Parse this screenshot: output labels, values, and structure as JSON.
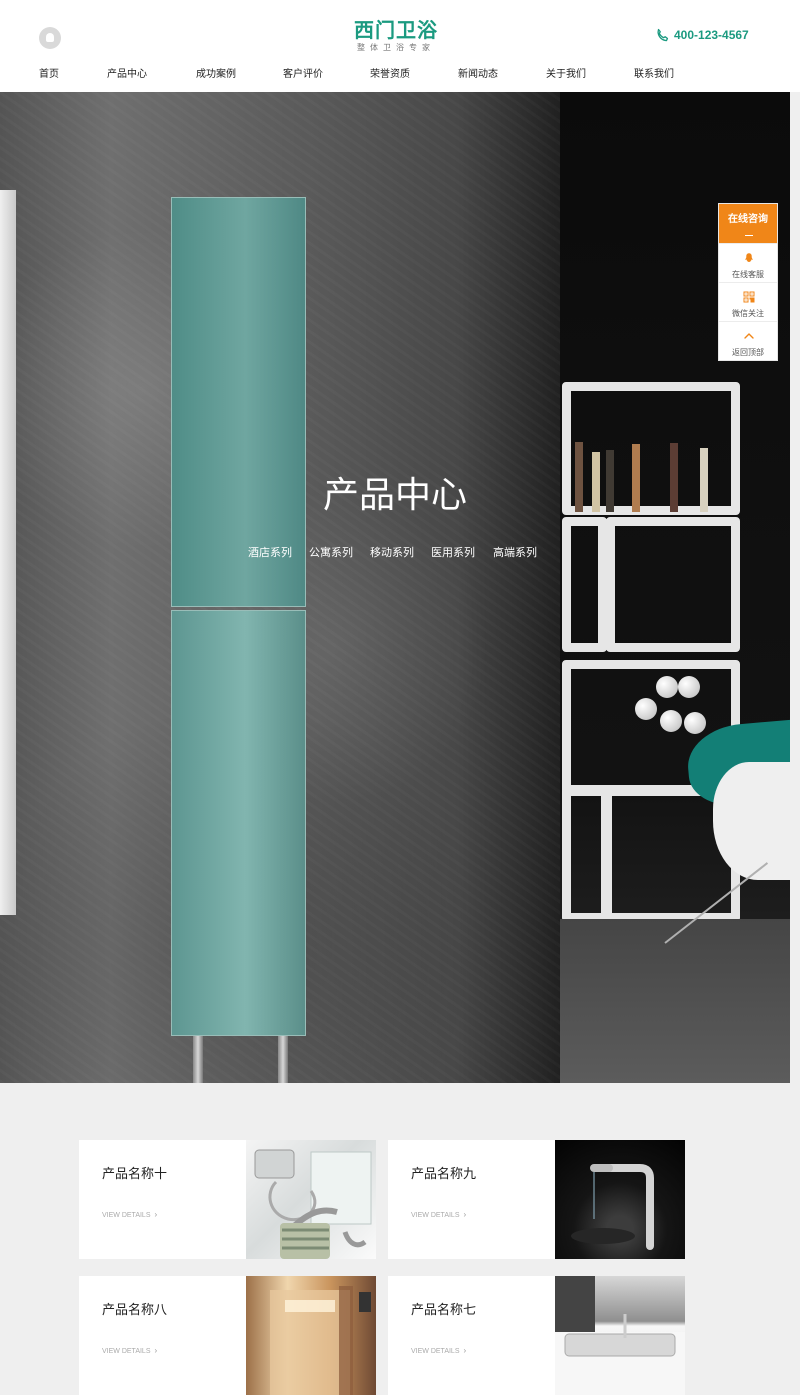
{
  "header": {
    "logo_title": "西门卫浴",
    "logo_subtitle": "整体卫浴专家",
    "phone": "400-123-4567"
  },
  "nav": {
    "items": [
      {
        "label": "首页"
      },
      {
        "label": "产品中心"
      },
      {
        "label": "成功案例"
      },
      {
        "label": "客户评价"
      },
      {
        "label": "荣誉资质"
      },
      {
        "label": "新闻动态"
      },
      {
        "label": "关于我们"
      },
      {
        "label": "联系我们"
      }
    ]
  },
  "hero": {
    "title": "产品中心",
    "categories": [
      {
        "label": "酒店系列"
      },
      {
        "label": "公寓系列"
      },
      {
        "label": "移动系列"
      },
      {
        "label": "医用系列"
      },
      {
        "label": "高端系列"
      }
    ]
  },
  "consult": {
    "title": "在线咨询",
    "items": [
      {
        "label": "在线客服",
        "icon": "qq-icon"
      },
      {
        "label": "微信关注",
        "icon": "qr-code-icon"
      },
      {
        "label": "返回顶部",
        "icon": "chevron-up-icon"
      }
    ]
  },
  "products": {
    "view_details": "VIEW DETAILS",
    "items": [
      {
        "title": "产品名称十"
      },
      {
        "title": "产品名称九"
      },
      {
        "title": "产品名称八"
      },
      {
        "title": "产品名称七"
      }
    ]
  },
  "colors": {
    "brand": "#1b9a80",
    "consult_accent": "#f08618"
  }
}
